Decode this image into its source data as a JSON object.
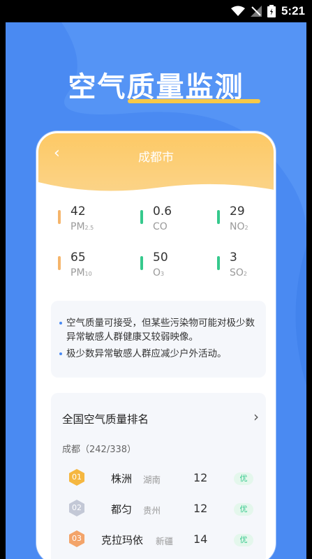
{
  "status_bar": {
    "time": "5:21",
    "icons": [
      "wifi-icon",
      "signal-icon",
      "battery-icon"
    ]
  },
  "headline": "空气质量监测",
  "app": {
    "city": "成都市",
    "metrics": [
      {
        "value": "42",
        "label": "PM",
        "sub": "2.5",
        "color": "#f5b56b"
      },
      {
        "value": "0.6",
        "label": "CO",
        "sub": "",
        "color": "#36c98d"
      },
      {
        "value": "29",
        "label": "NO",
        "sub": "2",
        "color": "#36c98d"
      },
      {
        "value": "65",
        "label": "PM",
        "sub": "10",
        "color": "#f5b56b"
      },
      {
        "value": "50",
        "label": "O",
        "sub": "3",
        "color": "#36c98d"
      },
      {
        "value": "3",
        "label": "SO",
        "sub": "2",
        "color": "#36c98d"
      }
    ],
    "tips": [
      "空气质量可接受，但某些污染物可能对极少数异常敏感人群健康又较弱映像。",
      "极少数异常敏感人群应减少户外活动。"
    ],
    "ranking": {
      "title": "全国空气质量排名",
      "subtitle": "成都（242/338）",
      "rows": [
        {
          "rank": "01",
          "city": "株洲",
          "province": "湖南",
          "value": "12",
          "grade": "优"
        },
        {
          "rank": "02",
          "city": "都匀",
          "province": "贵州",
          "value": "12",
          "grade": "优"
        },
        {
          "rank": "03",
          "city": "克拉玛依",
          "province": "新疆",
          "value": "14",
          "grade": "优"
        }
      ]
    }
  },
  "colors": {
    "accent": "#4a8af2",
    "header": "#fdc965",
    "good": "#36c98d",
    "warn": "#f5b56b",
    "underline": "#f7c948"
  }
}
